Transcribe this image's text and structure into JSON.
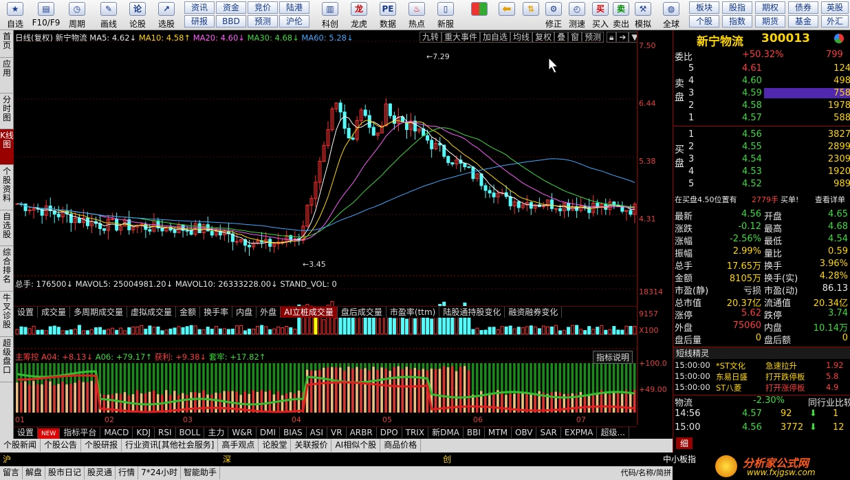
{
  "toolbar": {
    "items": [
      "自选",
      "F10/F9",
      "周期",
      "画线",
      "论股",
      "选股",
      "科创",
      "龙虎",
      "数据",
      "热点",
      "新服",
      "",
      "",
      "修正",
      "测速",
      "买入",
      "卖出",
      "模拟",
      "全球"
    ],
    "buttons": [
      "资讯",
      "资金",
      "竞价",
      "陆港",
      "研报",
      "BBD",
      "预测",
      "沪伦",
      "板块",
      "股指",
      "期权",
      "债券",
      "英股",
      "个股",
      "指数",
      "期货",
      "基金",
      "外汇"
    ]
  },
  "sidebar": {
    "items": [
      "首页",
      "应用",
      "分时图",
      "K线图",
      "个股资料",
      "自选股",
      "综合排名",
      "牛叉诊股",
      "超级盘口"
    ]
  },
  "chart": {
    "header": {
      "period": "日线(复权)",
      "name": "新宁物流",
      "ma5": "MA5: 4.62↓",
      "ma10": "MA10: 4.58↑",
      "ma20": "MA20: 4.60↓",
      "ma30": "MA30: 4.68↓",
      "ma60": "MA60: 5.28↓"
    },
    "header_buttons": [
      "九转",
      "重大事件",
      "加自选",
      "均线",
      "复权",
      "叠",
      "窗",
      "预测"
    ],
    "high_label": "7.29",
    "low_label": "3.45",
    "price_axis": [
      "7.50",
      "6.44",
      "5.38",
      "4.31"
    ],
    "volume_header": {
      "total": "总手: 176500↓",
      "mavol5": "MAVOL5: 25004981.20↓",
      "mavol10": "MAVOL10: 26333228.00↓",
      "stand": "STAND_VOL: 0"
    },
    "volume_axis": [
      "18314",
      "9157",
      "X100"
    ],
    "tabs1": [
      "设置",
      "成交量",
      "多周期成交量",
      "虚拟成交量",
      "金额",
      "换手率",
      "内盘",
      "外盘",
      "AI立桩成交量",
      "盘后成交量",
      "市盈率(ttm)",
      "陆股通持股变化",
      "融资融券变化"
    ],
    "indicator_header": {
      "name": "主筹控",
      "a04": "A04: +8.13↓",
      "a06": "A06: +79.17↑",
      "profit": "获利: +9.38↓",
      "trap": "套牢: +17.82↑"
    },
    "indicator_btn": "指标说明",
    "indicator_axis": [
      "+100.0",
      "+49.00"
    ],
    "months": [
      "01",
      "02",
      "03",
      "04",
      "05",
      "06",
      "07"
    ],
    "tabs2": [
      "设置",
      "NEW",
      "指标平台",
      "MACD",
      "KDJ",
      "RSI",
      "BOLL",
      "主力",
      "W&R",
      "DMI",
      "BIAS",
      "ASI",
      "VR",
      "ARBR",
      "DPO",
      "TRIX",
      "新DMA",
      "BBI",
      "MTM",
      "OBV",
      "SAR",
      "EXPMA",
      "超级..."
    ]
  },
  "bottombar": [
    "个股新闻",
    "个股公告",
    "个股研报",
    "行业资讯[其他社会服务]",
    "高手观点",
    "论股堂",
    "关联报价",
    "AI相似个股",
    "商品价格"
  ],
  "quote": {
    "name": "新宁物流",
    "code": "300013",
    "weibi_label": "委比",
    "weibi": "+50.32%",
    "weibi_r": "799",
    "sell": [
      {
        "lv": "5",
        "p": "4.61",
        "v": "124"
      },
      {
        "lv": "4",
        "p": "4.60",
        "v": "498"
      },
      {
        "lv": "3",
        "p": "4.59",
        "v": "758"
      },
      {
        "lv": "2",
        "p": "4.58",
        "v": "1978"
      },
      {
        "lv": "1",
        "p": "4.57",
        "v": "588"
      }
    ],
    "buy": [
      {
        "lv": "1",
        "p": "4.56",
        "v": "3827"
      },
      {
        "lv": "2",
        "p": "4.55",
        "v": "2899"
      },
      {
        "lv": "3",
        "p": "4.54",
        "v": "2309"
      },
      {
        "lv": "4",
        "p": "4.53",
        "v": "1920"
      },
      {
        "lv": "5",
        "p": "4.52",
        "v": "989"
      }
    ],
    "sell_label": "卖盘",
    "buy_label": "买盘",
    "note_a": "在买盘4.50位置有",
    "note_b": "2779手",
    "note_c": "买单!",
    "note_d": "查看详单",
    "stats": [
      [
        "最新",
        "4.56",
        "开盘",
        "4.65"
      ],
      [
        "涨跌",
        "-0.12",
        "最高",
        "4.68"
      ],
      [
        "涨幅",
        "-2.56%",
        "最低",
        "4.54"
      ],
      [
        "振幅",
        "2.99%",
        "量比",
        "0.59"
      ],
      [
        "总手",
        "17.65万",
        "换手",
        "3.96%"
      ],
      [
        "金额",
        "8105万",
        "换手(实)",
        "4.28%"
      ],
      [
        "市盈(静)",
        "亏损",
        "市盈(动)",
        "86.13"
      ],
      [
        "总市值",
        "20.37亿",
        "流通值",
        "20.34亿"
      ],
      [
        "涨停",
        "5.62",
        "跌停",
        "3.74"
      ],
      [
        "外盘",
        "75060",
        "内盘",
        "10.14万"
      ],
      [
        "盘后量",
        "0",
        "盘后额",
        "0"
      ]
    ],
    "short_title": "短线精灵",
    "short": [
      [
        "15:00:00",
        "*ST文化",
        "急速拉升",
        "1.92"
      ],
      [
        "15:00:00",
        "东易日盛",
        "打开跌停板",
        "5.8"
      ],
      [
        "15:00:00",
        "ST八菱",
        "打开涨停板",
        "4.9"
      ]
    ],
    "industry": "物流",
    "industry_pct": "-2.30%",
    "industry_cmp": "同行业比较",
    "ticks": [
      [
        "14:56",
        "4.57",
        "92"
      ],
      [
        "15:00",
        "4.56",
        "3772"
      ]
    ],
    "tick_tail": [
      "1",
      "12"
    ],
    "detail_tab": "细"
  },
  "status": {
    "market": [
      "沪",
      "深",
      "创",
      "中小板指"
    ],
    "items": [
      "留言",
      "解盘",
      "股市日记",
      "股灵通",
      "行情",
      "7*24小时",
      "智能助手"
    ],
    "right": "代码/名称/简拼",
    "logo": "分析家公式网",
    "url": "www.fxjgsw.com"
  }
}
